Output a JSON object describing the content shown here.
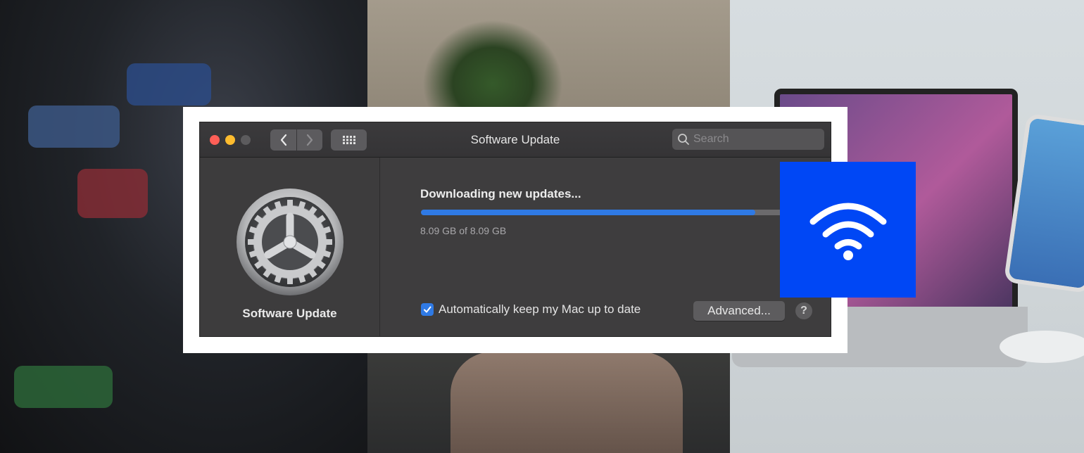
{
  "window": {
    "title": "Software Update",
    "search_placeholder": "Search",
    "controls": {
      "close": "red-close-button",
      "minimize": "yellow-minimize-button",
      "zoom": "gray-zoom-button",
      "back_icon": "chevron-left-icon",
      "forward_icon": "chevron-right-icon",
      "grid_icon": "grid-icon"
    }
  },
  "sidebar": {
    "icon": "gear-icon",
    "label": "Software Update"
  },
  "main": {
    "status": "Downloading new updates...",
    "progress_percent": 90,
    "size_text": "8.09 GB of 8.09 GB",
    "auto_update_label": "Automatically keep my Mac up to date",
    "auto_update_checked": true,
    "advanced_label": "Advanced...",
    "help_label": "?"
  },
  "overlay": {
    "icon": "wifi-icon",
    "color": "#0047f5"
  },
  "colors": {
    "accent": "#2f7ae5",
    "window_bg": "#3e3d3e",
    "frame": "#ffffff"
  }
}
